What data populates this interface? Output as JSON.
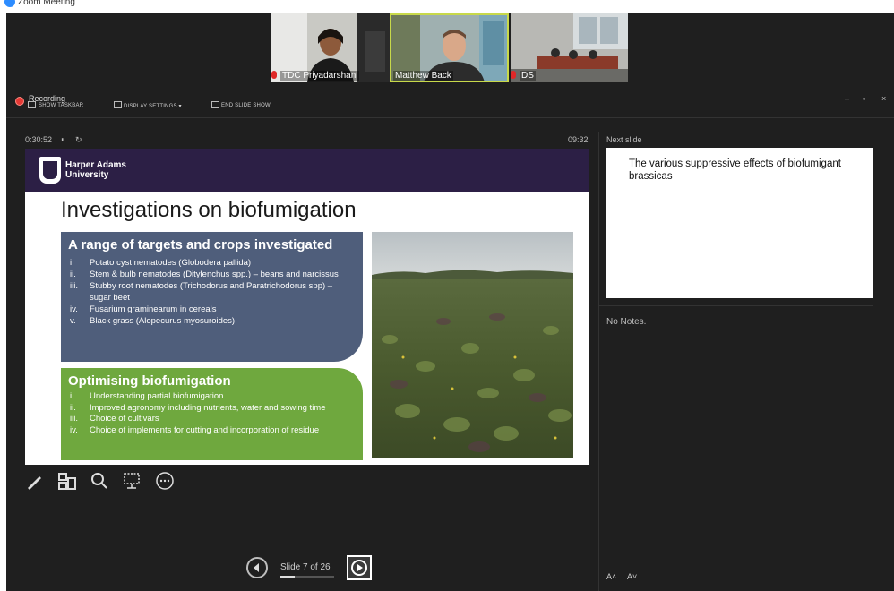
{
  "app": {
    "title": "Zoom Meeting"
  },
  "participants": [
    {
      "name": "TDC Priyadarshani",
      "muted": true
    },
    {
      "name": "Matthew Back",
      "muted": false
    },
    {
      "name": "DS",
      "muted": true
    }
  ],
  "toolbar": {
    "recording_label": "Recording",
    "show_taskbar": "SHOW TASKBAR",
    "display_settings": "DISPLAY SETTINGS ▾",
    "end_slide_show": "END SLIDE SHOW"
  },
  "presenter": {
    "elapsed": "0:30:52",
    "clock": "09:32",
    "next_slide_label": "Next slide",
    "next_slide_text": "The various suppressive effects of biofumigant brassicas",
    "notes": "No Notes.",
    "slide_counter": "Slide 7 of 26",
    "progress_fraction": 0.27
  },
  "slide": {
    "university": "Harper Adams\nUniversity",
    "title": "Investigations on biofumigation",
    "box1": {
      "heading": "A range of targets and crops investigated",
      "items": [
        {
          "num": "i.",
          "text": "Potato cyst nematodes (Globodera pallida)"
        },
        {
          "num": "ii.",
          "text": "Stem & bulb nematodes (Ditylenchus spp.) – beans and narcissus"
        },
        {
          "num": "iii.",
          "text": "Stubby root nematodes (Trichodorus and Paratrichodorus spp) – sugar beet"
        },
        {
          "num": "iv.",
          "text": "Fusarium graminearum in cereals"
        },
        {
          "num": "v.",
          "text": "Black grass (Alopecurus myosuroides)"
        }
      ]
    },
    "box2": {
      "heading": "Optimising biofumigation",
      "items": [
        {
          "num": "i.",
          "text": "Understanding partial biofumigation"
        },
        {
          "num": "ii.",
          "text": "Improved agronomy including nutrients, water and sowing time"
        },
        {
          "num": "iii.",
          "text": "Choice of cultivars"
        },
        {
          "num": "iv.",
          "text": "Choice of implements for cutting and incorporation of residue"
        }
      ]
    }
  },
  "controls": {
    "font_increase": "A˄",
    "font_decrease": "A˅"
  },
  "icons": [
    "pen-icon",
    "slides-grid-icon",
    "zoom-magnifier-icon",
    "screen-toggle-icon",
    "more-options-icon",
    "prev-slide-icon",
    "next-slide-icon"
  ],
  "colors": {
    "slide_header": "#2c1f45",
    "box_blue": "#4f5e7b",
    "box_green": "#6fa83e",
    "recording": "#e53935"
  }
}
